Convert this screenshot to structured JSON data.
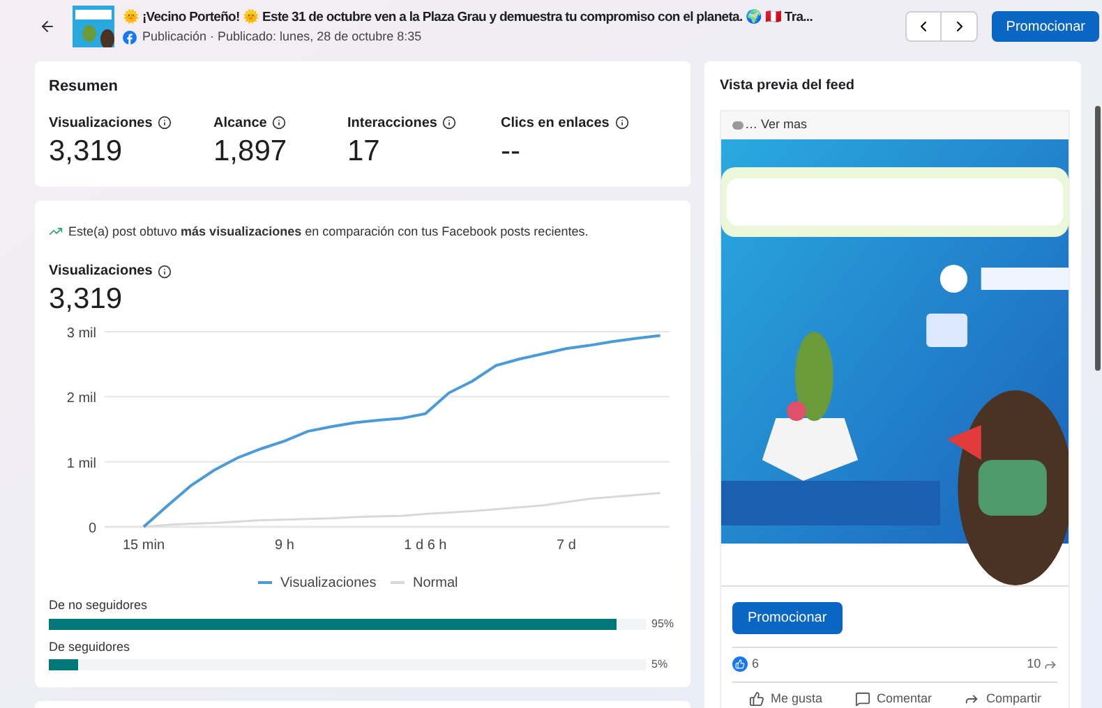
{
  "header": {
    "title": "🌞 ¡Vecino Porteño! 🌞 Este 31 de octubre ven a la Plaza Grau y demuestra tu compromiso con el planeta. 🌍 🇵🇪 Tra...",
    "subtitle": "Publicación · Publicado: lunes, 28 de octubre 8:35",
    "promote_button": "Promocionar"
  },
  "summary": {
    "title": "Resumen",
    "metrics": [
      {
        "label": "Visualizaciones",
        "value": "3,319"
      },
      {
        "label": "Alcance",
        "value": "1,897"
      },
      {
        "label": "Interacciones",
        "value": "17"
      },
      {
        "label": "Clics en enlaces",
        "value": "--"
      }
    ]
  },
  "views": {
    "insight_prefix": "Este(a) post obtuvo ",
    "insight_bold": "más visualizaciones",
    "insight_suffix": " en comparación con tus Facebook posts recientes.",
    "label": "Visualizaciones",
    "value": "3,319",
    "chart_data": {
      "type": "line",
      "categories": [
        "15 min",
        null,
        null,
        null,
        null,
        null,
        "9 h",
        null,
        null,
        null,
        null,
        null,
        "1 d 6 h",
        null,
        null,
        null,
        null,
        null,
        "7 d",
        null,
        null,
        null,
        null
      ],
      "series": [
        {
          "name": "Visualizaciones",
          "color": "#4a9bd6",
          "values": [
            0,
            0.32,
            0.63,
            0.87,
            1.06,
            1.2,
            1.32,
            1.47,
            1.54,
            1.6,
            1.64,
            1.67,
            1.74,
            2.06,
            2.24,
            2.48,
            2.58,
            2.66,
            2.74,
            2.79,
            2.85,
            2.9,
            2.94
          ]
        },
        {
          "name": "Normal",
          "color": "#d9d9d9",
          "values": [
            0,
            0.03,
            0.05,
            0.06,
            0.08,
            0.1,
            0.11,
            0.12,
            0.13,
            0.15,
            0.16,
            0.17,
            0.2,
            0.22,
            0.24,
            0.27,
            0.3,
            0.33,
            0.38,
            0.43,
            0.46,
            0.49,
            0.52
          ]
        }
      ],
      "ylim": [
        0,
        3
      ],
      "legend": "bottom",
      "yticks": [
        {
          "value": 0,
          "label": "0"
        },
        {
          "value": 1,
          "label": "1 mil"
        },
        {
          "value": 2,
          "label": "2 mil"
        },
        {
          "value": 3,
          "label": "3 mil"
        }
      ]
    },
    "audience": [
      {
        "label": "De no seguidores",
        "level": 0.95,
        "percent": "95%"
      },
      {
        "label": "De seguidores",
        "level": 0.05,
        "percent": "5%"
      }
    ]
  },
  "feed_preview": {
    "title": "Vista previa del feed",
    "see_more": "… Ver mas",
    "promote_button": "Promocionar",
    "likes": "6",
    "shares": "10",
    "actions": [
      {
        "kind": "like",
        "label": "Me gusta"
      },
      {
        "kind": "comment",
        "label": "Comentar"
      },
      {
        "kind": "share",
        "label": "Compartir"
      }
    ]
  }
}
